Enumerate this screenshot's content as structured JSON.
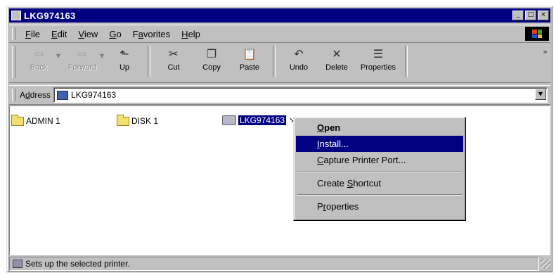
{
  "window": {
    "title": "LKG974163",
    "buttons": {
      "minimize": "_",
      "maximize": "□",
      "close": "×"
    }
  },
  "menu": {
    "items": [
      {
        "key": "F",
        "rest": "ile"
      },
      {
        "key": "E",
        "rest": "dit"
      },
      {
        "key": "V",
        "rest": "iew"
      },
      {
        "key": "G",
        "rest": "o"
      },
      {
        "pre": "F",
        "key": "a",
        "rest": "vorites"
      },
      {
        "key": "H",
        "rest": "elp"
      }
    ]
  },
  "toolbar": {
    "back": {
      "label": "Back",
      "icon": "back-arrow-icon",
      "glyph": "⇦"
    },
    "forward": {
      "label": "Forward",
      "icon": "forward-arrow-icon",
      "glyph": "⇨"
    },
    "up": {
      "label": "Up",
      "icon": "up-folder-icon",
      "glyph": "⬑"
    },
    "cut": {
      "label": "Cut",
      "icon": "scissors-icon",
      "glyph": "✂"
    },
    "copy": {
      "label": "Copy",
      "icon": "copy-icon",
      "glyph": "❐"
    },
    "paste": {
      "label": "Paste",
      "icon": "clipboard-icon",
      "glyph": "📋"
    },
    "undo": {
      "label": "Undo",
      "icon": "undo-icon",
      "glyph": "↶"
    },
    "delete": {
      "label": "Delete",
      "icon": "delete-x-icon",
      "glyph": "✕"
    },
    "properties": {
      "label": "Properties",
      "icon": "properties-icon",
      "glyph": "☰"
    },
    "more": "»"
  },
  "address": {
    "label_key": "d",
    "label_pre": "A",
    "label_rest": "dress",
    "value": "LKG974163"
  },
  "items": [
    {
      "label": "ADMIN 1",
      "type": "folder"
    },
    {
      "label": "DISK 1",
      "type": "folder"
    },
    {
      "label": "LKG974163",
      "type": "printer",
      "selected": true
    }
  ],
  "context_menu": {
    "items": [
      {
        "pre": "",
        "key": "O",
        "rest": "pen",
        "bold": true
      },
      {
        "pre": "",
        "key": "I",
        "rest": "nstall...",
        "highlighted": true
      },
      {
        "pre": "",
        "key": "C",
        "rest": "apture Printer Port..."
      },
      {
        "separator": true
      },
      {
        "pre": "Create ",
        "key": "S",
        "rest": "hortcut"
      },
      {
        "separator": true
      },
      {
        "pre": "P",
        "key": "r",
        "rest": "operties"
      }
    ]
  },
  "status": {
    "text": "Sets up the selected printer."
  },
  "colors": {
    "titlebar": "#000080",
    "selection": "#000080",
    "face": "#c0c0c0"
  }
}
